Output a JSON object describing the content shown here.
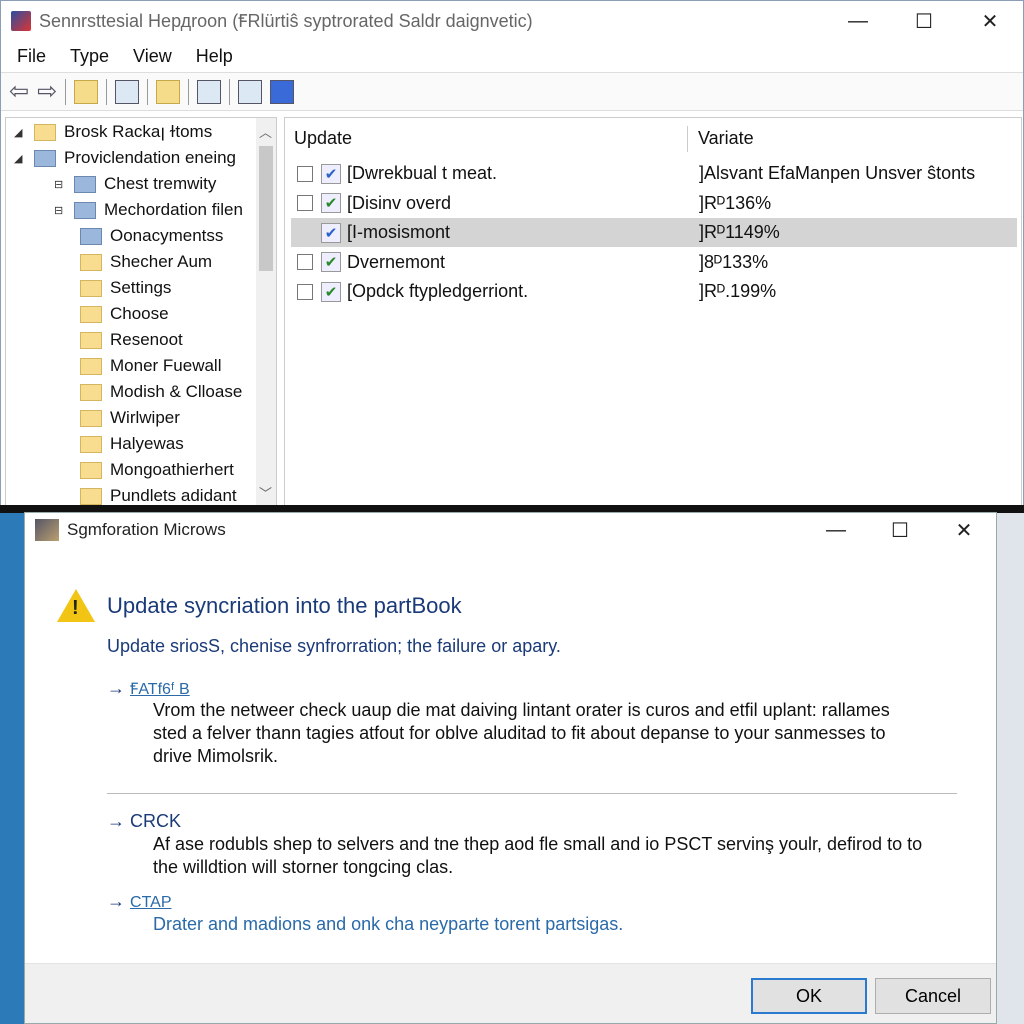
{
  "window": {
    "title": "Sennrsttesial Hердroon (ꞘRlürtiŝ syptrorated Saldr daignvetic)",
    "minimize": "—",
    "maximize": "☐",
    "close": "✕"
  },
  "menu": [
    "File",
    "Type",
    "View",
    "Help"
  ],
  "toolbar": {
    "back": "⇦",
    "forward": "⇨"
  },
  "tree": {
    "items": [
      {
        "label": "Brosk Rackaꞁ ɫtoms",
        "expander": "◢",
        "icon": "folder-icon"
      },
      {
        "label": "Proviclendation eneing",
        "expander": "◢",
        "icon": "network-icon"
      },
      {
        "label": "Chest tremwity",
        "expander": "⊟",
        "icon": "color-icon"
      },
      {
        "label": "Mechordation filen",
        "expander": "⊟",
        "icon": "gear-icon"
      },
      {
        "label": "Oonacymentss",
        "icon": "document-icon"
      },
      {
        "label": "Shecher Aum",
        "icon": "folder-icon"
      },
      {
        "label": "Settings",
        "icon": "folder-icon"
      },
      {
        "label": "Choose",
        "icon": "folder-icon"
      },
      {
        "label": "Resenoot",
        "icon": "folder-icon"
      },
      {
        "label": "Moner Fuewall",
        "icon": "folder-icon"
      },
      {
        "label": "Modish & Clloase",
        "icon": "folder-icon"
      },
      {
        "label": "Wirlwiper",
        "icon": "folder-icon"
      },
      {
        "label": "Halyewas",
        "icon": "folder-icon"
      },
      {
        "label": "Mongoathierhert",
        "icon": "folder-icon"
      },
      {
        "label": "Pundlets adidant",
        "icon": "folder-icon"
      }
    ]
  },
  "list": {
    "columns": [
      "Update",
      "Variate"
    ],
    "rows": [
      {
        "name": "[Dwrekbual t meat.",
        "value": "]Alsvant EfaManpen Unsver ŝtonts",
        "checked": false,
        "selected": false
      },
      {
        "name": "[Disinv overd",
        "value": "]Rᴰ136%",
        "checked": false,
        "selected": false
      },
      {
        "name": "[I-mosismont",
        "value": "]Rᴰ1149%",
        "checked": false,
        "selected": true
      },
      {
        "name": "Dvernemont",
        "value": "]8ᴰ133%",
        "checked": false,
        "selected": false
      },
      {
        "name": "[Opdck ftypledgerriont.",
        "value": "]Rᴰ.199%",
        "checked": false,
        "selected": false
      }
    ]
  },
  "dialog": {
    "title": "Sgmforation Microws",
    "heading": "Update syncriation into the partBook",
    "subtitle": "Update sriosS, chenise synfrorration; the failure or apary.",
    "sections": [
      {
        "arrow": "→",
        "label": "ꞘATf6ᶠ B",
        "text": "Vrom the netweer check uaup die mat daiving lintant orater is curos and etfil uplant: rallames sted a felver thann tagies atfout for oblve aluditad to fiŧ about depanse to your sanmesses to drive Mimolsrik."
      },
      {
        "arrow": "→",
        "label": "CRCK",
        "text": "Af ase rodubls shep to selvers and tne thep aod fle small and io PSCT servinş youlr, defirod to to the willdtion will storner tongcing clas."
      },
      {
        "arrow": "→",
        "label": "CTAP",
        "text": "Drater and madions and onk cha neyparte torent partsigas."
      }
    ],
    "ok": "OK",
    "cancel": "Cancel",
    "minimize": "—",
    "maximize": "☐",
    "close": "✕"
  },
  "colors": {
    "heading": "#1a3a78",
    "link": "#2a6aa8",
    "selected_row": "#d4d4d4",
    "warning": "#f2c515"
  }
}
